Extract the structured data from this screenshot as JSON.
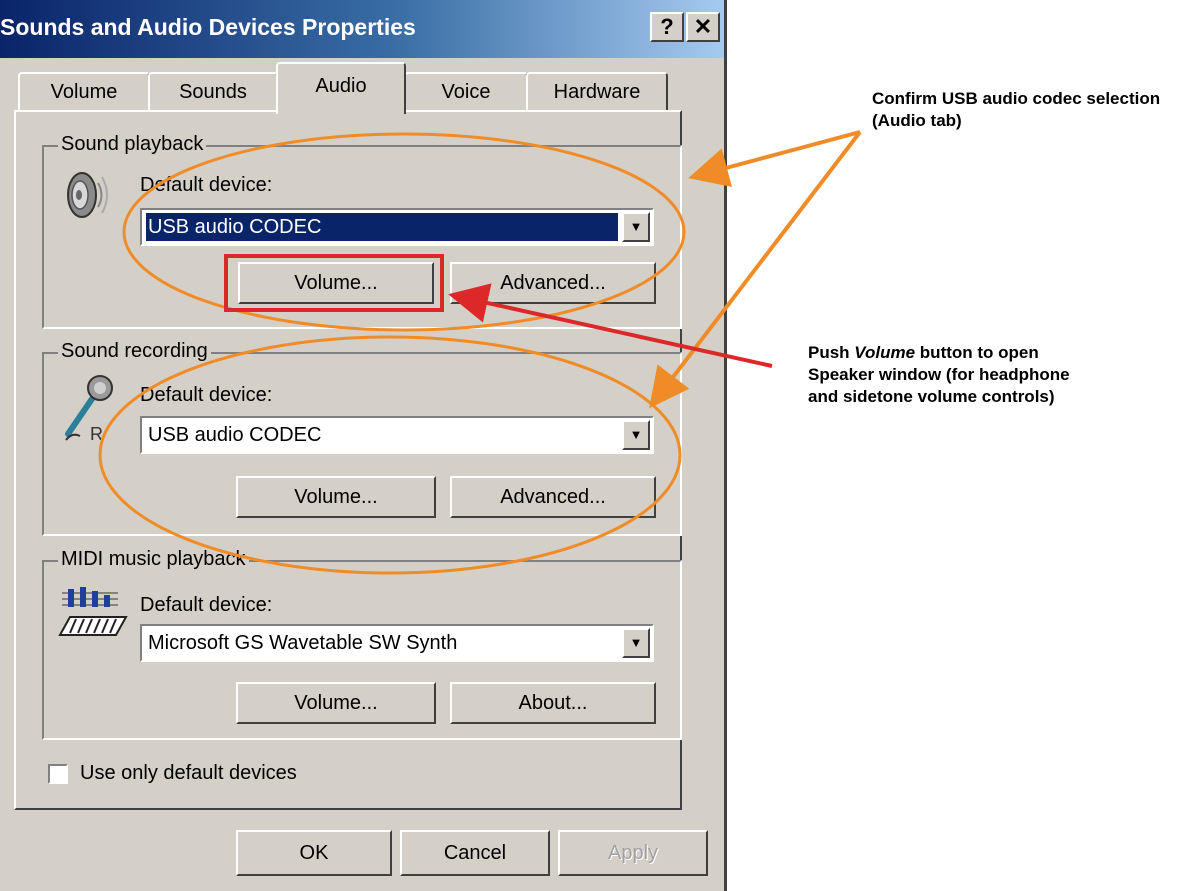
{
  "window": {
    "title": "Sounds and Audio Devices Properties",
    "help_button": "?",
    "close_button": "✕"
  },
  "tabs": [
    {
      "label": "Volume",
      "active": false
    },
    {
      "label": "Sounds",
      "active": false
    },
    {
      "label": "Audio",
      "active": true
    },
    {
      "label": "Voice",
      "active": false
    },
    {
      "label": "Hardware",
      "active": false
    }
  ],
  "sound_playback": {
    "group_label": "Sound playback",
    "device_label": "Default device:",
    "device_value": "USB audio CODEC",
    "volume_button": "Volume...",
    "advanced_button": "Advanced..."
  },
  "sound_recording": {
    "group_label": "Sound recording",
    "device_label": "Default device:",
    "device_value": "USB audio CODEC",
    "volume_button": "Volume...",
    "advanced_button": "Advanced..."
  },
  "midi_playback": {
    "group_label": "MIDI music playback",
    "device_label": "Default device:",
    "device_value": "Microsoft GS Wavetable SW Synth",
    "volume_button": "Volume...",
    "about_button": "About..."
  },
  "checkbox": {
    "label": "Use only default devices",
    "checked": false
  },
  "footer": {
    "ok_button": "OK",
    "cancel_button": "Cancel",
    "apply_button": "Apply"
  },
  "annotations": {
    "codec_note_line1": "Confirm USB audio codec selection",
    "codec_note_line2": "(Audio tab)",
    "volume_note_line1_pre": "Push ",
    "volume_note_line1_em": "Volume",
    "volume_note_line1_post": " button to open",
    "volume_note_line2": "Speaker window (for headphone",
    "volume_note_line3": "and sidetone volume controls)"
  },
  "colors": {
    "highlight_orange": "#f08c28",
    "highlight_red": "#dc2828",
    "title_bar": "#0a246a",
    "dialog_face": "#d4d0c8"
  }
}
